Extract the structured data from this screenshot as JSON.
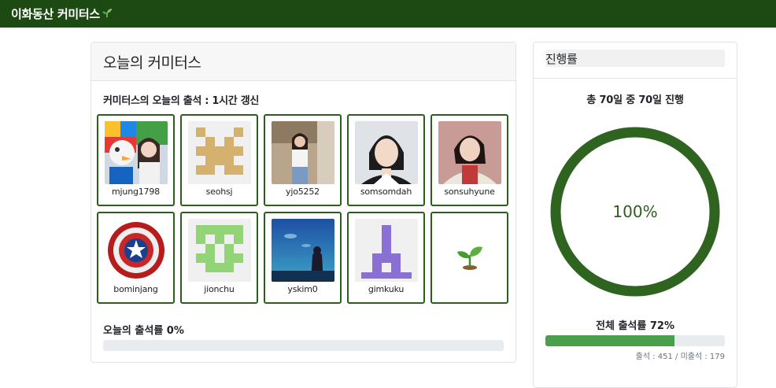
{
  "navbar": {
    "brand": "이화동산 커미터스"
  },
  "today": {
    "header": "오늘의 커미터스",
    "subtitle": "커미터스의 오늘의 출석 : 1시간 갱신",
    "members": [
      {
        "name": "mjung1798",
        "avatar": "photo"
      },
      {
        "name": "seohsj",
        "avatar": "identicon"
      },
      {
        "name": "yjo5252",
        "avatar": "photo"
      },
      {
        "name": "somsomdah",
        "avatar": "photo"
      },
      {
        "name": "sonsuhyune",
        "avatar": "photo"
      },
      {
        "name": "bominjang",
        "avatar": "captain-shield"
      },
      {
        "name": "jionchu",
        "avatar": "identicon"
      },
      {
        "name": "yskim0",
        "avatar": "aquarium-photo"
      },
      {
        "name": "gimkuku",
        "avatar": "identicon"
      },
      {
        "name": "",
        "avatar": "sprout"
      }
    ],
    "rate_label": "오늘의 출석률 0%",
    "rate_value": 0
  },
  "progress": {
    "header": "진행률",
    "total_text": "총 70일 중 70일 진행",
    "ring_label": "100%",
    "ring_value": 1.0,
    "overall_label": "전체 출석률 72%",
    "overall_value": 0.72,
    "counts": "출석 : 451 / 미출석 : 179"
  },
  "colors": {
    "nav": "#1d4a12",
    "accent": "#2c5e1e",
    "bar": "#4aa04a"
  }
}
